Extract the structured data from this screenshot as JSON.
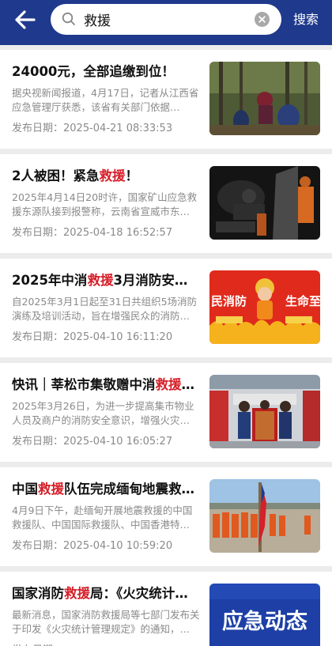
{
  "header": {
    "back_icon": "arrow-left-icon",
    "search_icon": "search-icon",
    "clear_icon": "clear-icon",
    "search_value": "救援",
    "search_button_label": "搜索",
    "background_color": "#1f3a8c"
  },
  "date_prefix": "发布日期：",
  "highlight_color": "#d6202a",
  "articles": [
    {
      "title_before": "24000元，全部追缴到位！",
      "title_highlight": "",
      "title_after": "",
      "summary": "据央视新闻报道，4月17日，记者从江西省应急管理厅获悉，该省有关部门依据…",
      "date": "2025-04-21 08:33:53",
      "thumb": "forest-rescue-photo"
    },
    {
      "title_before": "2人被困！紧急",
      "title_highlight": "救援",
      "title_after": "！",
      "summary": "2025年4月14日20时许，国家矿山应急救援东源队接到报警称，云南省宣威市东…",
      "date": "2025-04-18 16:52:57",
      "thumb": "mine-rescue-photo"
    },
    {
      "title_before": "2025年中消",
      "title_highlight": "救援",
      "title_after": "3月消防安全…",
      "summary": "自2025年3月1日起至31日共组织5场消防演练及培训活动，旨在增强民众的消防…",
      "date": "2025-04-10 16:11:20",
      "thumb": "fire-safety-poster",
      "poster_left": "民消防",
      "poster_right": "生命至"
    },
    {
      "title_before": "快讯｜莘松市集敬赠中消",
      "title_highlight": "救援",
      "title_after": "…",
      "summary": "2025年3月26日，为进一步提高集市物业人员及商户的消防安全意识，增强火灾…",
      "date": "2025-04-10 16:05:27",
      "thumb": "banner-presentation-photo"
    },
    {
      "title_before": "中国",
      "title_highlight": "救援",
      "title_after": "队伍完成缅甸地震救…",
      "summary": "4月9日下午，赴缅甸开展地震救援的中国救援队、中国国际救援队、中国香港特…",
      "date": "2025-04-10 10:59:20",
      "thumb": "team-ceremony-photo"
    },
    {
      "title_before": "国家消防",
      "title_highlight": "救援",
      "title_after": "局：《火灾统计管…",
      "summary": "最新消息，国家消防救援局等七部门发布关于印发《火灾统计管理规定》的通知，…",
      "date": "",
      "thumb": "emergency-news-graphic",
      "graphic_text": "应急动态"
    }
  ]
}
